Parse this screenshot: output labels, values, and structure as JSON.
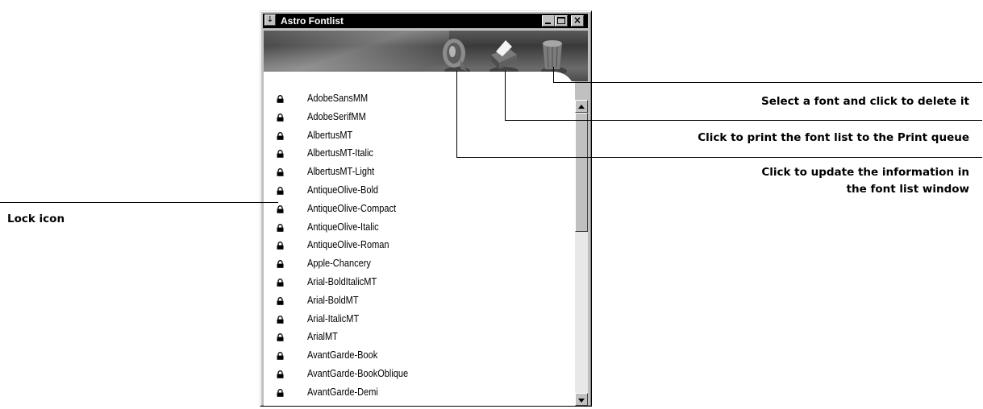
{
  "window": {
    "title": "Astro Fontlist",
    "sysmenu_glyph": "↓",
    "close_glyph": "×"
  },
  "toolbar": {
    "icons": [
      "update-icon",
      "print-icon",
      "delete-icon"
    ]
  },
  "fonts": [
    "AdobeSansMM",
    "AdobeSerifMM",
    "AlbertusMT",
    "AlbertusMT-Italic",
    "AlbertusMT-Light",
    "AntiqueOlive-Bold",
    "AntiqueOlive-Compact",
    "AntiqueOlive-Italic",
    "AntiqueOlive-Roman",
    "Apple-Chancery",
    "Arial-BoldItalicMT",
    "Arial-BoldMT",
    "Arial-ItalicMT",
    "ArialMT",
    "AvantGarde-Book",
    "AvantGarde-BookOblique",
    "AvantGarde-Demi"
  ],
  "callouts": {
    "delete": "Select a font and click to delete it",
    "print": "Click to print the font list to the Print queue",
    "update_line1": "Click to update the information in",
    "update_line2": "the font list window",
    "lock": "Lock icon"
  },
  "colors": {
    "titlebar": "#000000",
    "header": "#4a4a4a",
    "window": "#c0c0c0"
  }
}
